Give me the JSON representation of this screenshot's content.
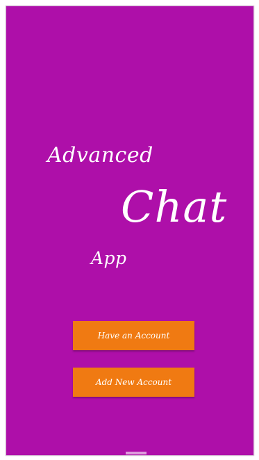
{
  "title": {
    "line1": "Advanced",
    "line2": "Chat",
    "line3": "App"
  },
  "buttons": {
    "have_account": "Have an Account",
    "add_account": "Add New Account"
  },
  "colors": {
    "background": "#ae0fa9",
    "button": "#f07a12",
    "text": "#ffffff"
  }
}
